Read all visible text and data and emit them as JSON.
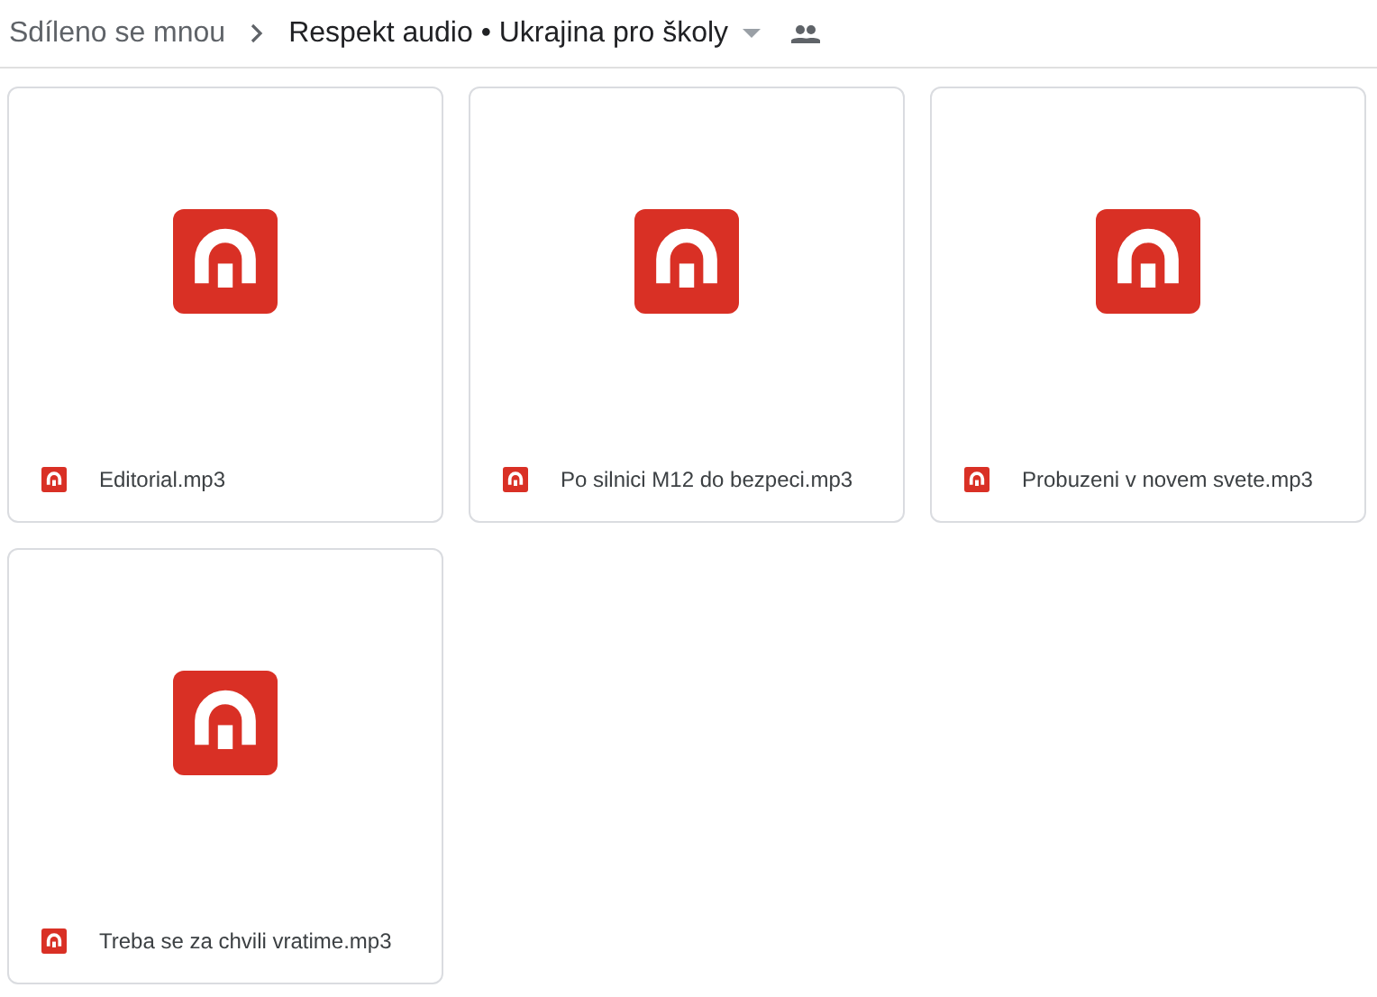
{
  "breadcrumb": {
    "parent": "Sdíleno se mnou",
    "current": "Respekt audio • Ukrajina pro školy"
  },
  "files": [
    {
      "name": "Editorial.mp3"
    },
    {
      "name": "Po silnici M12 do bezpeci.mp3"
    },
    {
      "name": "Probuzeni v novem svete.mp3"
    },
    {
      "name": "Treba se za chvili vratime.mp3"
    }
  ]
}
